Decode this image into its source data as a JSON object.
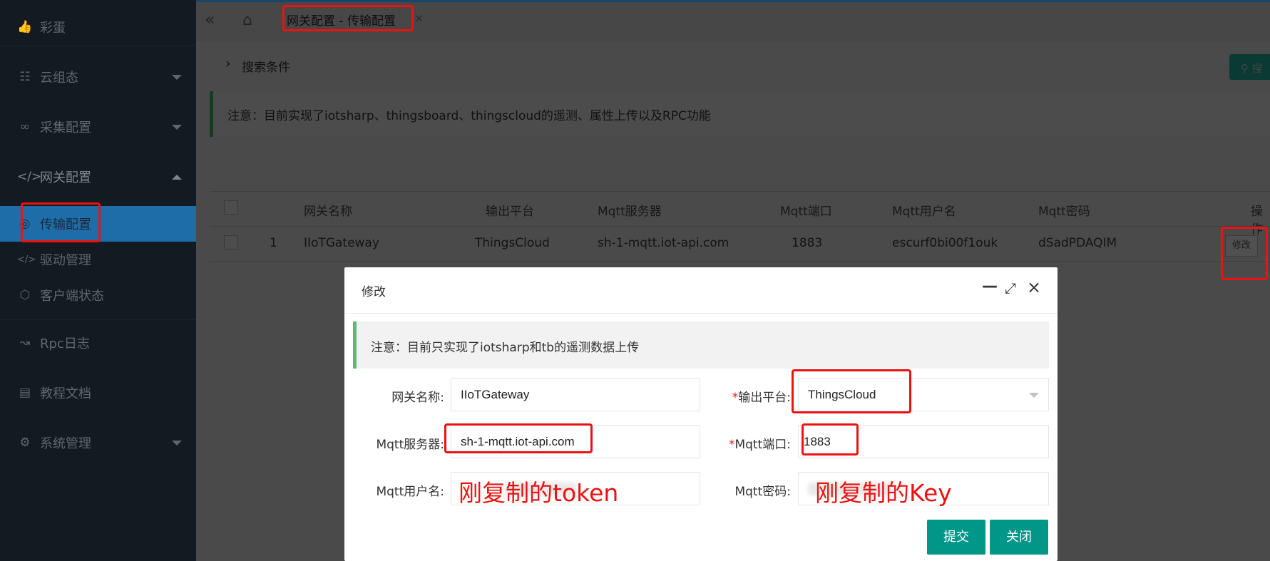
{
  "sidebar": {
    "items": [
      {
        "label": "彩蛋",
        "icon": "thumbs-up-icon"
      },
      {
        "label": "云组态",
        "icon": "network-icon"
      },
      {
        "label": "采集配置",
        "icon": "link-icon"
      },
      {
        "label": "网关配置",
        "icon": "code-icon"
      },
      {
        "label": "传输配置",
        "icon": "broadcast-icon"
      },
      {
        "label": "驱动管理",
        "icon": "code-icon"
      },
      {
        "label": "客户端状态",
        "icon": "cube-icon"
      },
      {
        "label": "Rpc日志",
        "icon": "trend-icon"
      },
      {
        "label": "教程文档",
        "icon": "document-icon"
      },
      {
        "label": "系统管理",
        "icon": "gear-icon"
      }
    ]
  },
  "topbar": {
    "tab_label": "网关配置 - 传输配置",
    "collapse_icon": "double-chevron-left-icon",
    "home_icon": "home-icon"
  },
  "search": {
    "label": "搜索条件",
    "button_label": "搜"
  },
  "main_notice": "注意：目前实现了iotsharp、thingsboard、thingscloud的遥测、属性上传以及RPC功能",
  "table": {
    "headers": [
      "网关名称",
      "输出平台",
      "Mqtt服务器",
      "Mqtt端口",
      "Mqtt用户名",
      "Mqtt密码",
      "操作"
    ],
    "rows": [
      {
        "index": "1",
        "gateway_name": "IIoTGateway",
        "platform": "ThingsCloud",
        "server": "sh-1-mqtt.iot-api.com",
        "port": "1883",
        "username": "escurf0bi00f1ouk",
        "password": "dSadPDAQIM",
        "action": "修改"
      }
    ]
  },
  "modal": {
    "title": "修改",
    "notice": "注意：目前只实现了iotsharp和tb的遥测数据上传",
    "fields": {
      "gateway_name_label": "网关名称:",
      "gateway_name_value": "IIoTGateway",
      "platform_label": "输出平台:",
      "platform_value": "ThingsCloud",
      "server_label": "Mqtt服务器:",
      "server_value": "sh-1-mqtt.iot-api.com",
      "port_label": "Mqtt端口:",
      "port_value": "1883",
      "username_label": "Mqtt用户名:",
      "password_label": "Mqtt密码:",
      "required_mark": "*"
    },
    "annotations": {
      "username_note": "刚复制的token",
      "password_note": "刚复制的Key"
    },
    "buttons": {
      "submit": "提交",
      "close": "关闭"
    }
  },
  "colors": {
    "sidebar_bg": "#141a22",
    "active_item": "#1f6da8",
    "primary_button": "#009688",
    "annotation_red": "#ee1111",
    "notice_border": "#5fb878"
  }
}
